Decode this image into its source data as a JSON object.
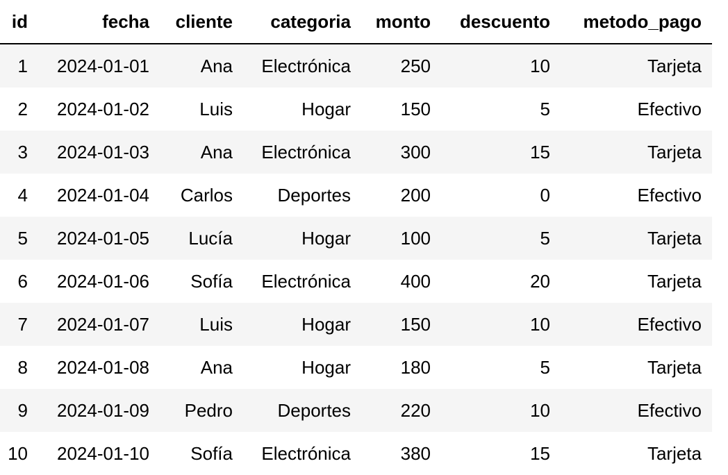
{
  "table": {
    "columns": [
      "id",
      "fecha",
      "cliente",
      "categoria",
      "monto",
      "descuento",
      "metodo_pago"
    ],
    "rows": [
      [
        "1",
        "2024-01-01",
        "Ana",
        "Electrónica",
        "250",
        "10",
        "Tarjeta"
      ],
      [
        "2",
        "2024-01-02",
        "Luis",
        "Hogar",
        "150",
        "5",
        "Efectivo"
      ],
      [
        "3",
        "2024-01-03",
        "Ana",
        "Electrónica",
        "300",
        "15",
        "Tarjeta"
      ],
      [
        "4",
        "2024-01-04",
        "Carlos",
        "Deportes",
        "200",
        "0",
        "Efectivo"
      ],
      [
        "5",
        "2024-01-05",
        "Lucía",
        "Hogar",
        "100",
        "5",
        "Tarjeta"
      ],
      [
        "6",
        "2024-01-06",
        "Sofía",
        "Electrónica",
        "400",
        "20",
        "Tarjeta"
      ],
      [
        "7",
        "2024-01-07",
        "Luis",
        "Hogar",
        "150",
        "10",
        "Efectivo"
      ],
      [
        "8",
        "2024-01-08",
        "Ana",
        "Hogar",
        "180",
        "5",
        "Tarjeta"
      ],
      [
        "9",
        "2024-01-09",
        "Pedro",
        "Deportes",
        "220",
        "10",
        "Efectivo"
      ],
      [
        "10",
        "2024-01-10",
        "Sofía",
        "Electrónica",
        "380",
        "15",
        "Tarjeta"
      ]
    ]
  }
}
